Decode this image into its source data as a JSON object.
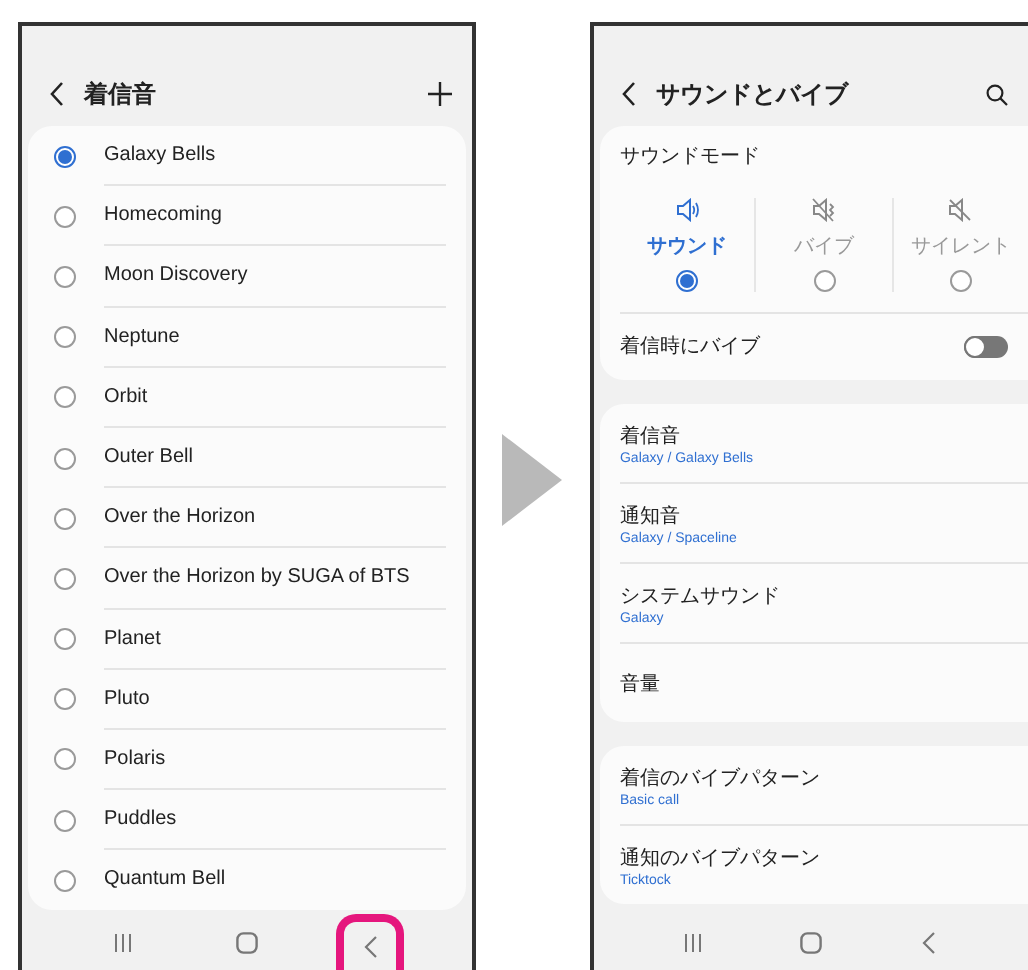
{
  "left_screen": {
    "title": "着信音",
    "ringtones": [
      {
        "name": "Galaxy Bells",
        "selected": true
      },
      {
        "name": "Homecoming",
        "selected": false
      },
      {
        "name": "Moon Discovery",
        "selected": false
      },
      {
        "name": "Neptune",
        "selected": false
      },
      {
        "name": "Orbit",
        "selected": false
      },
      {
        "name": "Outer Bell",
        "selected": false
      },
      {
        "name": "Over the Horizon",
        "selected": false
      },
      {
        "name": "Over the Horizon by SUGA of BTS",
        "selected": false
      },
      {
        "name": "Planet",
        "selected": false
      },
      {
        "name": "Pluto",
        "selected": false
      },
      {
        "name": "Polaris",
        "selected": false
      },
      {
        "name": "Puddles",
        "selected": false
      },
      {
        "name": "Quantum Bell",
        "selected": false
      }
    ],
    "nav": [
      {
        "kind": "recents",
        "highlighted": false
      },
      {
        "kind": "home",
        "highlighted": false
      },
      {
        "kind": "back",
        "highlighted": true
      }
    ]
  },
  "right_screen": {
    "title": "サウンドとバイブ",
    "sound_mode": {
      "label": "サウンドモード",
      "modes": [
        {
          "kind": "sound",
          "label": "サウンド",
          "selected": true
        },
        {
          "kind": "vibrate",
          "label": "バイブ",
          "selected": false
        },
        {
          "kind": "silent",
          "label": "サイレント",
          "selected": false
        }
      ]
    },
    "vibrate_on_ring": {
      "label": "着信時にバイブ",
      "on": false
    },
    "setting_groups": [
      [
        {
          "title": "着信音",
          "value": "Galaxy / Galaxy Bells"
        },
        {
          "title": "通知音",
          "value": "Galaxy / Spaceline"
        },
        {
          "title": "システムサウンド",
          "value": "Galaxy"
        },
        {
          "title": "音量"
        }
      ],
      [
        {
          "title": "着信のバイブパターン",
          "value": "Basic call"
        },
        {
          "title": "通知のバイブパターン",
          "value": "Ticktock"
        }
      ]
    ],
    "nav": [
      {
        "kind": "recents",
        "highlighted": false
      },
      {
        "kind": "home",
        "highlighted": false
      },
      {
        "kind": "back",
        "highlighted": false
      }
    ]
  }
}
